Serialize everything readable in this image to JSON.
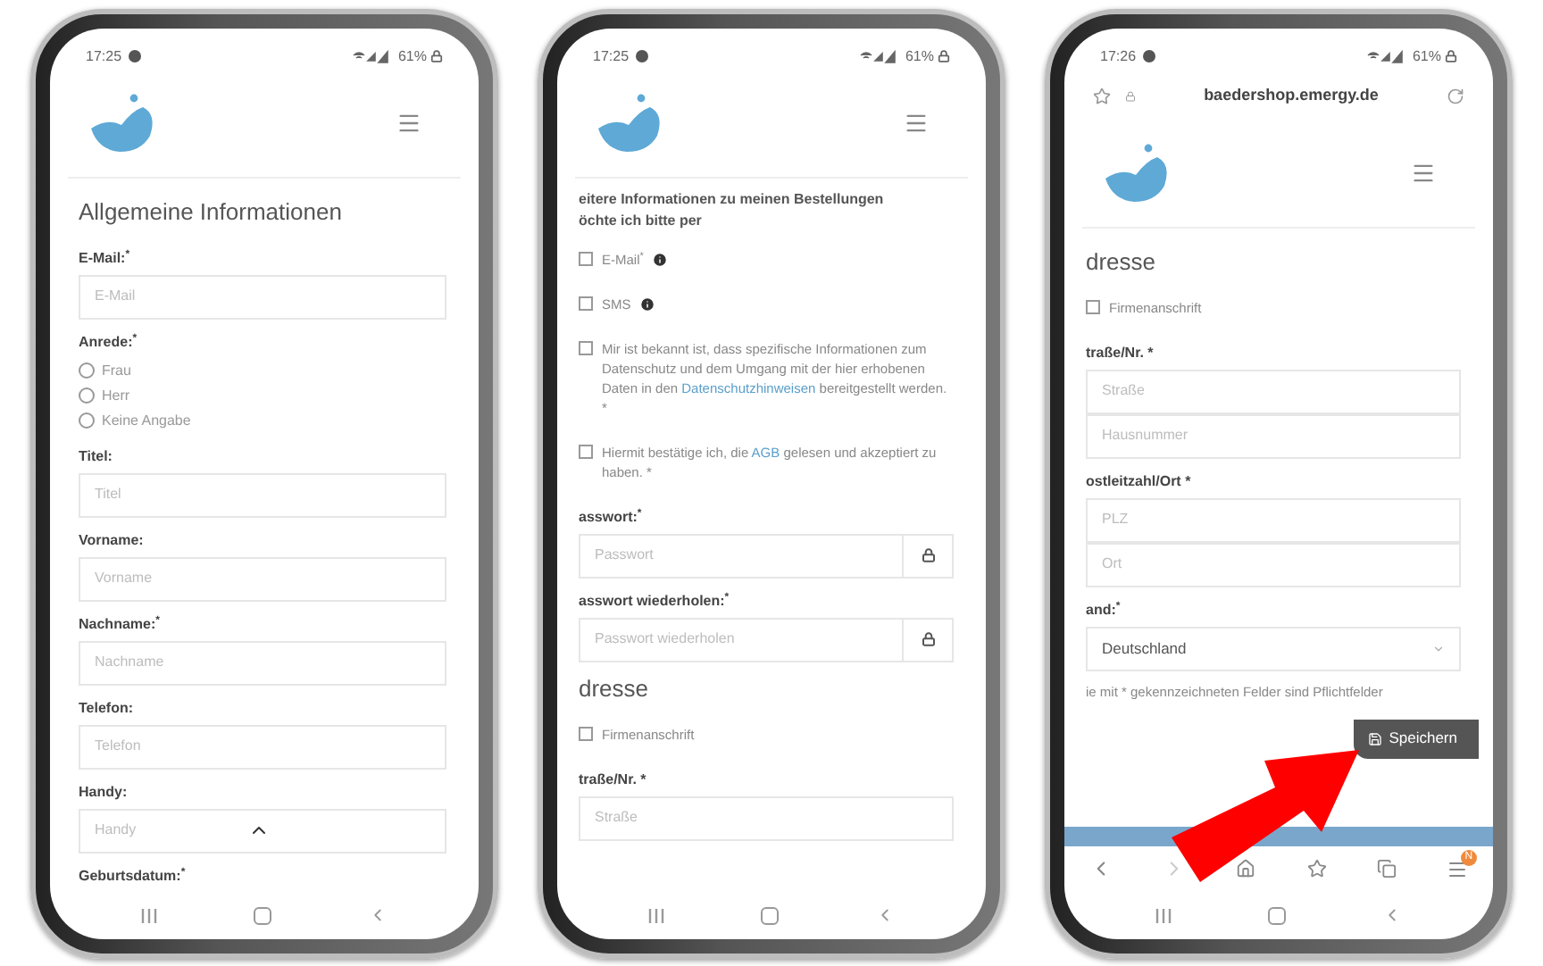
{
  "phones": [
    {
      "status_bar": {
        "time": "17:25",
        "battery": "61%"
      },
      "content": [
        {
          "kind": "heading",
          "text": "Allgemeine Informationen"
        },
        {
          "kind": "label",
          "text": "E-Mail:$^{*}$"
        },
        {
          "kind": "field",
          "placeholder": "E-Mail"
        },
        {
          "kind": "label",
          "text": "Anrede:$^{*}$"
        },
        {
          "kind": "radio",
          "text": "Frau",
          "selected": false
        },
        {
          "kind": "radio",
          "text": "Herr",
          "selected": false
        },
        {
          "kind": "radio",
          "text": "Keine Angabe",
          "selected": false
        },
        {
          "kind": "label",
          "text": "Titel:"
        },
        {
          "kind": "field",
          "placeholder": "Titel"
        },
        {
          "kind": "label",
          "text": "Vorname:"
        },
        {
          "kind": "field",
          "placeholder": "Vorname"
        },
        {
          "kind": "label",
          "text": "Nachname:$^{*}$"
        },
        {
          "kind": "field",
          "placeholder": "Nachname"
        },
        {
          "kind": "label",
          "text": "Telefon:"
        },
        {
          "kind": "field",
          "placeholder": "Telefon"
        },
        {
          "kind": "label",
          "text": "Handy:"
        },
        {
          "kind": "field",
          "placeholder": "Handy",
          "scroll_top_button": true
        },
        {
          "kind": "label",
          "text": "Geburtsdatum:$^{*}$"
        }
      ]
    },
    {
      "status_bar": {
        "time": "17:25",
        "battery": "61%"
      },
      "content": [
        {
          "kind": "paragraph",
          "text": "eitere Informationen zu meinen Bestellungen öchte ich bitte per"
        },
        {
          "kind": "checkbox",
          "parts": [
            {
              "text": "E-Mail$^{*}$",
              "link": false
            }
          ],
          "checked": false,
          "info": true
        },
        {
          "kind": "checkbox",
          "parts": [
            {
              "text": "SMS",
              "link": false
            }
          ],
          "checked": false,
          "info": true
        },
        {
          "kind": "checkbox",
          "parts": [
            {
              "text": "Mir ist bekannt ist, dass spezifische Informationen zum Datenschutz und dem Umgang mit der hier erhobenen Daten in den",
              "link": false
            },
            {
              "text": "Datenschutzhinweisen",
              "link": true
            },
            {
              "text": "bereitgestellt werden. *",
              "link": false
            }
          ],
          "checked": false,
          "info": false
        },
        {
          "kind": "checkbox",
          "parts": [
            {
              "text": "Hiermit bestätige ich, die",
              "link": false
            },
            {
              "text": "AGB",
              "link": true
            },
            {
              "text": "gelesen und akzeptiert zu haben. *",
              "link": false
            }
          ],
          "checked": false,
          "info": false
        },
        {
          "kind": "label",
          "text": "asswort:$^{*}$"
        },
        {
          "kind": "field",
          "placeholder": "Passwort",
          "lock": true
        },
        {
          "kind": "label",
          "text": "asswort wiederholen:$^{*}$"
        },
        {
          "kind": "field",
          "placeholder": "Passwort wiederholen",
          "lock": true
        },
        {
          "kind": "heading",
          "text": "dresse"
        },
        {
          "kind": "checkbox",
          "parts": [
            {
              "text": "Firmenanschrift",
              "link": false
            }
          ],
          "checked": false,
          "info": false
        },
        {
          "kind": "label",
          "text": "traße/Nr. *"
        },
        {
          "kind": "field",
          "placeholder": "Straße"
        }
      ]
    },
    {
      "status_bar": {
        "time": "17:26",
        "battery": "61%"
      },
      "address_bar": {
        "url": "baedershop.emergy.de"
      },
      "content": [
        {
          "kind": "heading",
          "text": "dresse"
        },
        {
          "kind": "checkbox",
          "parts": [
            {
              "text": "Firmenanschrift",
              "link": false
            }
          ],
          "checked": false,
          "info": false
        },
        {
          "kind": "label",
          "text": "traße/Nr. *"
        },
        {
          "kind": "field",
          "placeholder": "Straße"
        },
        {
          "kind": "field",
          "placeholder": "Hausnummer"
        },
        {
          "kind": "label",
          "text": "ostleitzahl/Ort *"
        },
        {
          "kind": "field",
          "placeholder": "PLZ"
        },
        {
          "kind": "field",
          "placeholder": "Ort"
        },
        {
          "kind": "label",
          "text": "and:$^{*}$"
        },
        {
          "kind": "select",
          "value": "Deutschland"
        },
        {
          "kind": "note",
          "text": "ie mit * gekennzeichneten Felder sind Pflichtfelder"
        },
        {
          "kind": "save",
          "text": "Speichern"
        }
      ],
      "browser_toolbar": {
        "badge": "N"
      },
      "annotation": {
        "kind": "arrow"
      }
    }
  ]
}
